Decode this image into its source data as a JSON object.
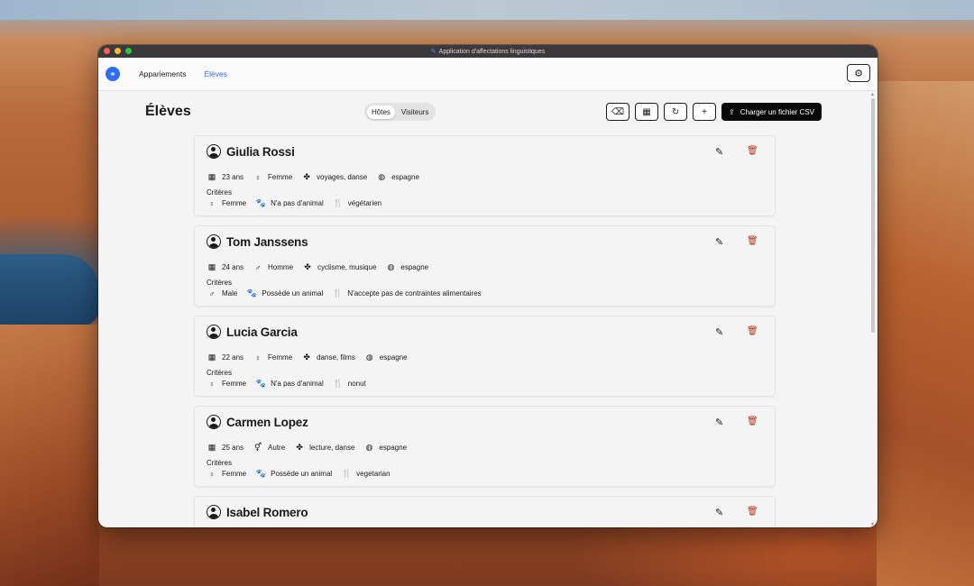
{
  "window": {
    "title": "Application d'affectations linguistiques"
  },
  "nav": {
    "items": [
      {
        "label": "Appariements",
        "active": false
      },
      {
        "label": "Élèves",
        "active": true
      }
    ]
  },
  "page": {
    "title": "Élèves"
  },
  "segments": [
    {
      "label": "Hôtes",
      "active": true
    },
    {
      "label": "Visiteurs",
      "active": false
    }
  ],
  "toolbar": {
    "csv_label": "Charger un fichier CSV"
  },
  "criteria_label": "Critères",
  "students": [
    {
      "name": "Giulia Rossi",
      "age": "23 ans",
      "gender": "Femme",
      "gender_icon": "female-icon",
      "interests": "voyages, danse",
      "country": "espagne",
      "crit_gender": "Femme",
      "crit_gender_icon": "female-icon",
      "crit_animal": "N'a pas d'animal",
      "crit_diet": "végétarien"
    },
    {
      "name": "Tom Janssens",
      "age": "24 ans",
      "gender": "Homme",
      "gender_icon": "male-icon",
      "interests": "cyclisme, musique",
      "country": "espagne",
      "crit_gender": "Male",
      "crit_gender_icon": "male-icon",
      "crit_animal": "Possède un animal",
      "crit_diet": "N'accepte pas de contraintes alimentaires"
    },
    {
      "name": "Lucia Garcia",
      "age": "22 ans",
      "gender": "Femme",
      "gender_icon": "female-icon",
      "interests": "danse, films",
      "country": "espagne",
      "crit_gender": "Femme",
      "crit_gender_icon": "female-icon",
      "crit_animal": "N'a pas d'animal",
      "crit_diet": "nonut"
    },
    {
      "name": "Carmen Lopez",
      "age": "25 ans",
      "gender": "Autre",
      "gender_icon": "other-gender-icon",
      "interests": "lecture, danse",
      "country": "espagne",
      "crit_gender": "Femme",
      "crit_gender_icon": "female-icon",
      "crit_animal": "Possède un animal",
      "crit_diet": "vegetarian"
    },
    {
      "name": "Isabel Romero"
    }
  ]
}
